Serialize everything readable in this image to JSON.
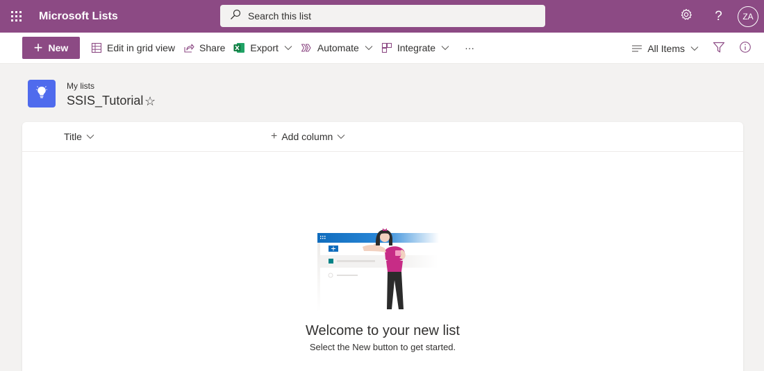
{
  "suite": {
    "app_name": "Microsoft Lists",
    "search_placeholder": "Search this list",
    "help_label": "?",
    "user_initials": "ZA"
  },
  "command_bar": {
    "new_label": "New",
    "edit_grid_label": "Edit in grid view",
    "share_label": "Share",
    "export_label": "Export",
    "automate_label": "Automate",
    "integrate_label": "Integrate",
    "more_label": "···",
    "view_label": "All Items"
  },
  "list": {
    "breadcrumb": "My lists",
    "title": "SSIS_Tutorial",
    "favorite_glyph": "☆",
    "columns": {
      "title": "Title",
      "add_column": "Add column",
      "add_plus": "+"
    },
    "empty_state": {
      "heading": "Welcome to your new list",
      "subtext": "Select the New button to get started."
    }
  },
  "icons": {
    "app_launcher": "waffle-icon",
    "search": "search-icon",
    "settings": "gear-icon",
    "grid_view": "grid-icon",
    "share": "share-icon",
    "export": "excel-icon",
    "automate": "automate-icon",
    "integrate": "integrate-icon",
    "view": "lines-icon",
    "filter": "filter-icon",
    "info": "info-icon",
    "list": "lightbulb-icon"
  },
  "colors": {
    "brand": "#8c4a84",
    "list_icon": "#4f6bed",
    "excel": "#107c41"
  }
}
